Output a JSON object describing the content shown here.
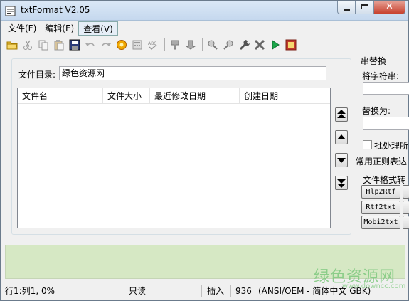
{
  "window": {
    "title": "txtFormat V2.05",
    "close_glyph": "✕"
  },
  "menu": [
    {
      "label": "文件(F)"
    },
    {
      "label": "编辑(E)"
    },
    {
      "label": "查看(V)"
    }
  ],
  "toolbar": {
    "icons": [
      "open-folder-icon",
      "cut-icon",
      "copy-icon",
      "paste-icon",
      "save-icon",
      "undo-icon",
      "redo-icon",
      "settings-gear-icon",
      "calculator-icon",
      "spellcheck-icon",
      "format-left-icon",
      "format-right-icon",
      "find-icon",
      "search-icon",
      "wrench-icon",
      "tools-icon",
      "run-icon",
      "book-icon"
    ]
  },
  "directory": {
    "label": "文件目录:",
    "value": "绿色资源网"
  },
  "file_list": {
    "columns": [
      "文件名",
      "文件大小",
      "最近修改日期",
      "创建日期"
    ],
    "rows": []
  },
  "replace_group": {
    "title": "串替换",
    "find_label": "将字符串:",
    "replace_label": "替换为:",
    "batch_label": "批处理所",
    "regex_label": "常用正则表达"
  },
  "convert_group": {
    "title": "文件格式转",
    "buttons": [
      "Hlp2Rtf",
      "Rtf2txt",
      "Mobi2txt"
    ]
  },
  "status": {
    "position": "行1:列1, 0%",
    "readonly": "只读",
    "insert": "插入",
    "codepage": "936",
    "encoding": "(ANSI/OEM - 简体中文 GBK)"
  },
  "watermark": {
    "text": "绿色资源网",
    "sub": "www.downcc.com"
  },
  "colors": {
    "log_bg": "#d6e8c4",
    "watermark": "#7fc97f",
    "close_button": "#c7412e"
  }
}
